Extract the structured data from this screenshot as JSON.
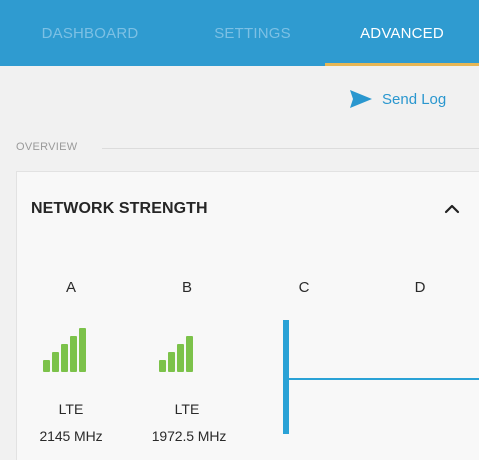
{
  "tabs": [
    {
      "label": "DASHBOARD",
      "active": false
    },
    {
      "label": "SETTINGS",
      "active": false
    },
    {
      "label": "ADVANCED",
      "active": true
    }
  ],
  "actions": {
    "send_log": "Send Log",
    "send_icon": "send-icon"
  },
  "overview": {
    "label": "OVERVIEW"
  },
  "network_strength": {
    "title": "NETWORK STRENGTH",
    "collapse_icon": "chevron-up-icon",
    "columns": [
      {
        "label": "A",
        "tech": "LTE",
        "frequency": "2145 MHz",
        "signal_bars": 5
      },
      {
        "label": "B",
        "tech": "LTE",
        "frequency": "1972.5 MHz",
        "signal_bars": 4
      },
      {
        "label": "C"
      },
      {
        "label": "D"
      }
    ]
  },
  "colors": {
    "tab_bar": "#2f9bd0",
    "tab_indicator": "#e7b654",
    "accent": "#2a97cf",
    "signal": "#7cc24a"
  }
}
